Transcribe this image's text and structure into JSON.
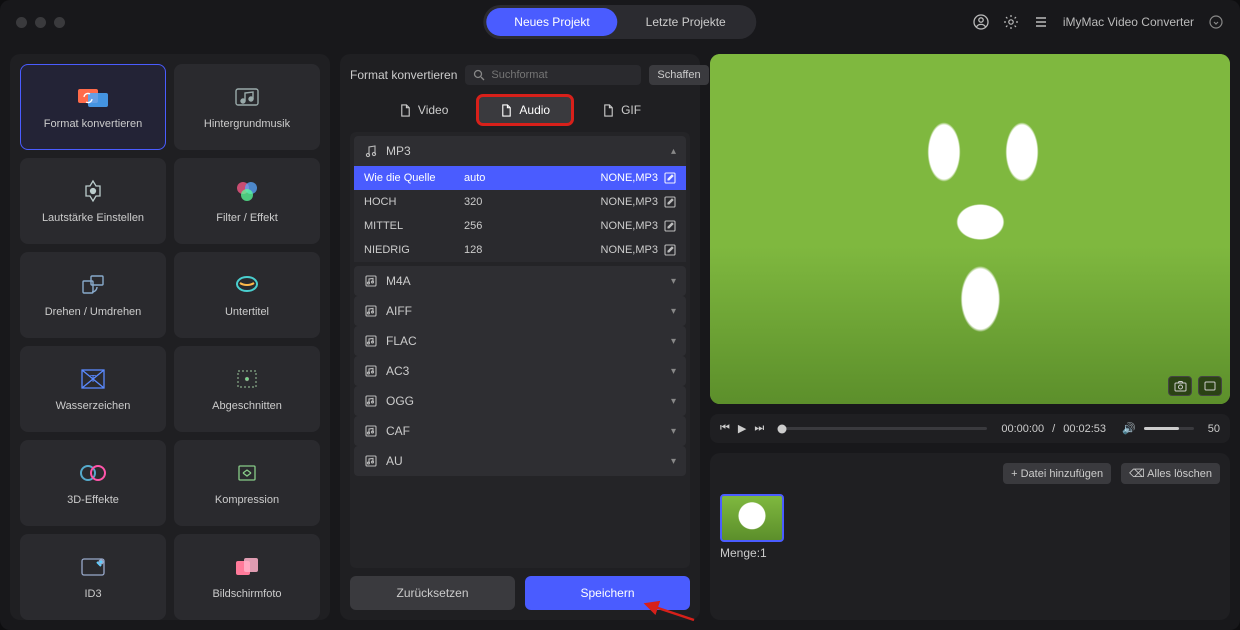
{
  "app_title": "iMyMac Video Converter",
  "top_tabs": {
    "new": "Neues Projekt",
    "recent": "Letzte Projekte"
  },
  "sidebar": [
    {
      "label": "Format konvertieren",
      "key": "format-convert",
      "active": true
    },
    {
      "label": "Hintergrundmusik",
      "key": "bgm"
    },
    {
      "label": "Lautstärke Einstellen",
      "key": "volume"
    },
    {
      "label": "Filter / Effekt",
      "key": "filter"
    },
    {
      "label": "Drehen / Umdrehen",
      "key": "rotate"
    },
    {
      "label": "Untertitel",
      "key": "subtitle"
    },
    {
      "label": "Wasserzeichen",
      "key": "watermark"
    },
    {
      "label": "Abgeschnitten",
      "key": "crop"
    },
    {
      "label": "3D-Effekte",
      "key": "3d"
    },
    {
      "label": "Kompression",
      "key": "compress"
    },
    {
      "label": "ID3",
      "key": "id3"
    },
    {
      "label": "Bildschirmfoto",
      "key": "screenshot"
    }
  ],
  "mid": {
    "title": "Format konvertieren",
    "search_placeholder": "Suchformat",
    "create_btn": "Schaffen",
    "close": "✕",
    "tabs": {
      "video": "Video",
      "audio": "Audio",
      "gif": "GIF"
    },
    "mp3_header": "MP3",
    "mp3_rows": [
      {
        "name": "Wie die Quelle",
        "br": "auto",
        "codec": "NONE,MP3",
        "sel": true
      },
      {
        "name": "HOCH",
        "br": "320",
        "codec": "NONE,MP3"
      },
      {
        "name": "MITTEL",
        "br": "256",
        "codec": "NONE,MP3"
      },
      {
        "name": "NIEDRIG",
        "br": "128",
        "codec": "NONE,MP3"
      }
    ],
    "other_formats": [
      "M4A",
      "AIFF",
      "FLAC",
      "AC3",
      "OGG",
      "CAF",
      "AU"
    ],
    "reset": "Zurücksetzen",
    "save": "Speichern"
  },
  "player": {
    "time_current": "00:00:00",
    "time_total": "00:02:53",
    "time_sep": " / ",
    "volume_value": "50"
  },
  "files": {
    "add": "+ Datei hinzufügen",
    "clear": "Alles löschen",
    "clear_icon": "⌫",
    "count_label": "Menge:",
    "count_value": "1"
  }
}
